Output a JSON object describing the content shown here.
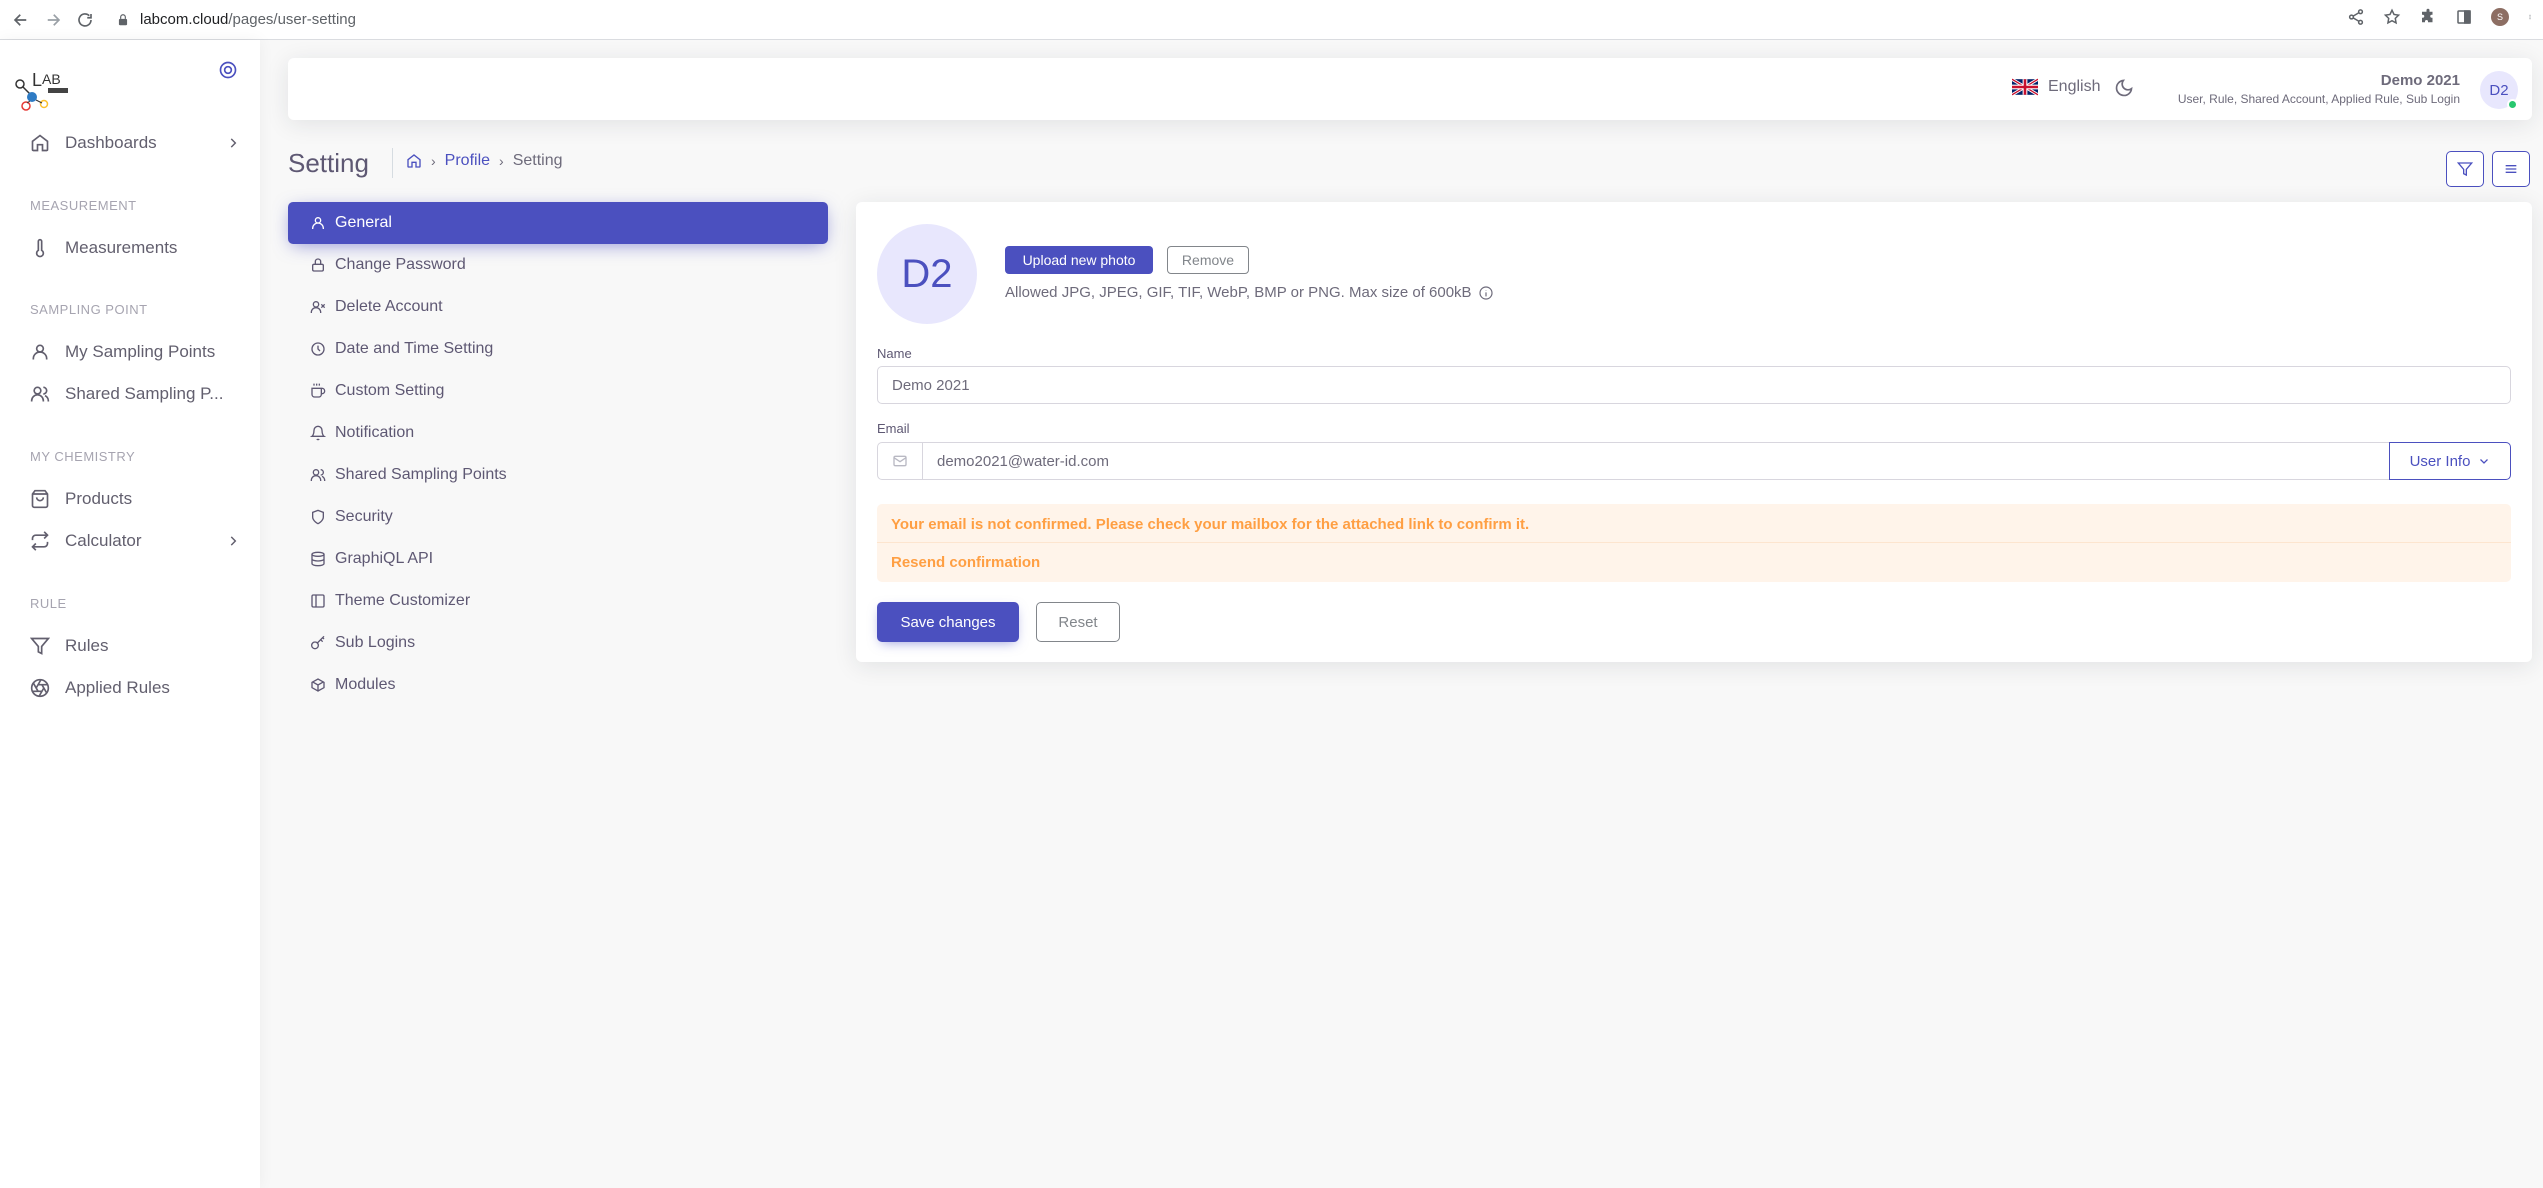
{
  "browser": {
    "url_host": "labcom.cloud",
    "url_path": "/pages/user-setting",
    "profile_initial": "S"
  },
  "sidebar": {
    "items": [
      {
        "label": "Dashboards",
        "icon": "home-icon"
      },
      {
        "header": "MEASUREMENT"
      },
      {
        "label": "Measurements",
        "icon": "thermometer-icon"
      },
      {
        "header": "SAMPLING POINT"
      },
      {
        "label": "My Sampling Points",
        "icon": "user-icon"
      },
      {
        "label": "Shared Sampling P...",
        "icon": "users-icon"
      },
      {
        "header": "MY CHEMISTRY"
      },
      {
        "label": "Products",
        "icon": "shopping-bag-icon"
      },
      {
        "label": "Calculator",
        "icon": "repeat-icon"
      },
      {
        "header": "RULE"
      },
      {
        "label": "Rules",
        "icon": "filter-icon"
      },
      {
        "label": "Applied Rules",
        "icon": "aperture-icon"
      }
    ]
  },
  "topbar": {
    "language": "English",
    "user_name": "Demo 2021",
    "user_roles": "User, Rule, Shared Account, Applied Rule, Sub Login",
    "avatar_initials": "D2"
  },
  "page": {
    "title": "Setting",
    "breadcrumb": [
      "Profile",
      "Setting"
    ]
  },
  "settings_menu": [
    {
      "label": "General",
      "icon": "user-icon",
      "active": true
    },
    {
      "label": "Change Password",
      "icon": "lock-icon"
    },
    {
      "label": "Delete Account",
      "icon": "user-x-icon"
    },
    {
      "label": "Date and Time Setting",
      "icon": "clock-icon"
    },
    {
      "label": "Custom Setting",
      "icon": "coffee-icon"
    },
    {
      "label": "Notification",
      "icon": "bell-icon"
    },
    {
      "label": "Shared Sampling Points",
      "icon": "users-icon"
    },
    {
      "label": "Security",
      "icon": "shield-icon"
    },
    {
      "label": "GraphiQL API",
      "icon": "database-icon"
    },
    {
      "label": "Theme Customizer",
      "icon": "layout-icon"
    },
    {
      "label": "Sub Logins",
      "icon": "key-icon"
    },
    {
      "label": "Modules",
      "icon": "box-icon"
    }
  ],
  "general": {
    "avatar_initials": "D2",
    "upload_label": "Upload new photo",
    "remove_label": "Remove",
    "allowed_text": "Allowed JPG, JPEG, GIF, TIF, WebP, BMP or PNG. Max size of 600kB",
    "name_label": "Name",
    "name_value": "Demo 2021",
    "email_label": "Email",
    "email_value": "demo2021@water-id.com",
    "user_info_label": "User Info",
    "alert_text": "Your email is not confirmed. Please check your mailbox for the attached link to confirm it.",
    "resend_label": "Resend confirmation",
    "save_label": "Save changes",
    "reset_label": "Reset"
  },
  "colors": {
    "primary": "#4b50bf",
    "warning": "#ff9f43",
    "success": "#28c76f"
  }
}
